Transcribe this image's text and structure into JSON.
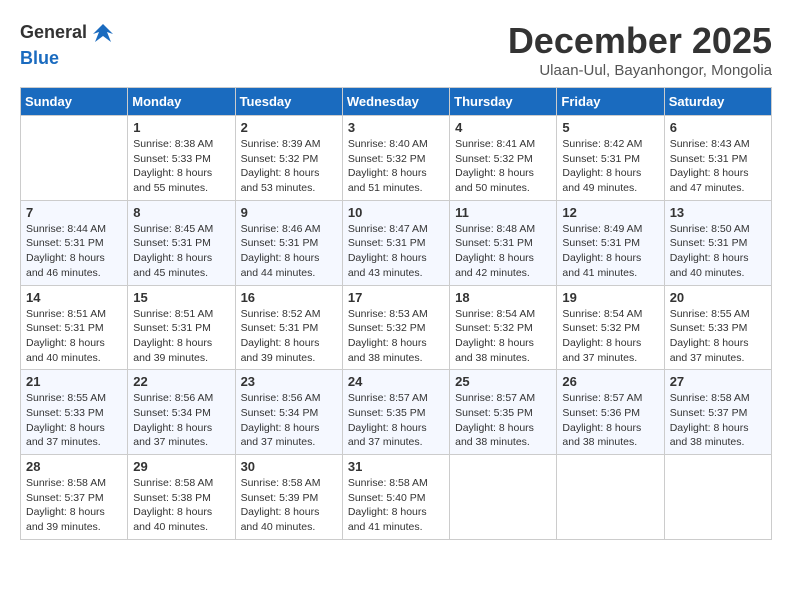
{
  "header": {
    "logo_general": "General",
    "logo_blue": "Blue",
    "month_title": "December 2025",
    "subtitle": "Ulaan-Uul, Bayanhongor, Mongolia"
  },
  "days_of_week": [
    "Sunday",
    "Monday",
    "Tuesday",
    "Wednesday",
    "Thursday",
    "Friday",
    "Saturday"
  ],
  "weeks": [
    [
      {
        "day": "",
        "sunrise": "",
        "sunset": "",
        "daylight": ""
      },
      {
        "day": "1",
        "sunrise": "Sunrise: 8:38 AM",
        "sunset": "Sunset: 5:33 PM",
        "daylight": "Daylight: 8 hours and 55 minutes."
      },
      {
        "day": "2",
        "sunrise": "Sunrise: 8:39 AM",
        "sunset": "Sunset: 5:32 PM",
        "daylight": "Daylight: 8 hours and 53 minutes."
      },
      {
        "day": "3",
        "sunrise": "Sunrise: 8:40 AM",
        "sunset": "Sunset: 5:32 PM",
        "daylight": "Daylight: 8 hours and 51 minutes."
      },
      {
        "day": "4",
        "sunrise": "Sunrise: 8:41 AM",
        "sunset": "Sunset: 5:32 PM",
        "daylight": "Daylight: 8 hours and 50 minutes."
      },
      {
        "day": "5",
        "sunrise": "Sunrise: 8:42 AM",
        "sunset": "Sunset: 5:31 PM",
        "daylight": "Daylight: 8 hours and 49 minutes."
      },
      {
        "day": "6",
        "sunrise": "Sunrise: 8:43 AM",
        "sunset": "Sunset: 5:31 PM",
        "daylight": "Daylight: 8 hours and 47 minutes."
      }
    ],
    [
      {
        "day": "7",
        "sunrise": "Sunrise: 8:44 AM",
        "sunset": "Sunset: 5:31 PM",
        "daylight": "Daylight: 8 hours and 46 minutes."
      },
      {
        "day": "8",
        "sunrise": "Sunrise: 8:45 AM",
        "sunset": "Sunset: 5:31 PM",
        "daylight": "Daylight: 8 hours and 45 minutes."
      },
      {
        "day": "9",
        "sunrise": "Sunrise: 8:46 AM",
        "sunset": "Sunset: 5:31 PM",
        "daylight": "Daylight: 8 hours and 44 minutes."
      },
      {
        "day": "10",
        "sunrise": "Sunrise: 8:47 AM",
        "sunset": "Sunset: 5:31 PM",
        "daylight": "Daylight: 8 hours and 43 minutes."
      },
      {
        "day": "11",
        "sunrise": "Sunrise: 8:48 AM",
        "sunset": "Sunset: 5:31 PM",
        "daylight": "Daylight: 8 hours and 42 minutes."
      },
      {
        "day": "12",
        "sunrise": "Sunrise: 8:49 AM",
        "sunset": "Sunset: 5:31 PM",
        "daylight": "Daylight: 8 hours and 41 minutes."
      },
      {
        "day": "13",
        "sunrise": "Sunrise: 8:50 AM",
        "sunset": "Sunset: 5:31 PM",
        "daylight": "Daylight: 8 hours and 40 minutes."
      }
    ],
    [
      {
        "day": "14",
        "sunrise": "Sunrise: 8:51 AM",
        "sunset": "Sunset: 5:31 PM",
        "daylight": "Daylight: 8 hours and 40 minutes."
      },
      {
        "day": "15",
        "sunrise": "Sunrise: 8:51 AM",
        "sunset": "Sunset: 5:31 PM",
        "daylight": "Daylight: 8 hours and 39 minutes."
      },
      {
        "day": "16",
        "sunrise": "Sunrise: 8:52 AM",
        "sunset": "Sunset: 5:31 PM",
        "daylight": "Daylight: 8 hours and 39 minutes."
      },
      {
        "day": "17",
        "sunrise": "Sunrise: 8:53 AM",
        "sunset": "Sunset: 5:32 PM",
        "daylight": "Daylight: 8 hours and 38 minutes."
      },
      {
        "day": "18",
        "sunrise": "Sunrise: 8:54 AM",
        "sunset": "Sunset: 5:32 PM",
        "daylight": "Daylight: 8 hours and 38 minutes."
      },
      {
        "day": "19",
        "sunrise": "Sunrise: 8:54 AM",
        "sunset": "Sunset: 5:32 PM",
        "daylight": "Daylight: 8 hours and 37 minutes."
      },
      {
        "day": "20",
        "sunrise": "Sunrise: 8:55 AM",
        "sunset": "Sunset: 5:33 PM",
        "daylight": "Daylight: 8 hours and 37 minutes."
      }
    ],
    [
      {
        "day": "21",
        "sunrise": "Sunrise: 8:55 AM",
        "sunset": "Sunset: 5:33 PM",
        "daylight": "Daylight: 8 hours and 37 minutes."
      },
      {
        "day": "22",
        "sunrise": "Sunrise: 8:56 AM",
        "sunset": "Sunset: 5:34 PM",
        "daylight": "Daylight: 8 hours and 37 minutes."
      },
      {
        "day": "23",
        "sunrise": "Sunrise: 8:56 AM",
        "sunset": "Sunset: 5:34 PM",
        "daylight": "Daylight: 8 hours and 37 minutes."
      },
      {
        "day": "24",
        "sunrise": "Sunrise: 8:57 AM",
        "sunset": "Sunset: 5:35 PM",
        "daylight": "Daylight: 8 hours and 37 minutes."
      },
      {
        "day": "25",
        "sunrise": "Sunrise: 8:57 AM",
        "sunset": "Sunset: 5:35 PM",
        "daylight": "Daylight: 8 hours and 38 minutes."
      },
      {
        "day": "26",
        "sunrise": "Sunrise: 8:57 AM",
        "sunset": "Sunset: 5:36 PM",
        "daylight": "Daylight: 8 hours and 38 minutes."
      },
      {
        "day": "27",
        "sunrise": "Sunrise: 8:58 AM",
        "sunset": "Sunset: 5:37 PM",
        "daylight": "Daylight: 8 hours and 38 minutes."
      }
    ],
    [
      {
        "day": "28",
        "sunrise": "Sunrise: 8:58 AM",
        "sunset": "Sunset: 5:37 PM",
        "daylight": "Daylight: 8 hours and 39 minutes."
      },
      {
        "day": "29",
        "sunrise": "Sunrise: 8:58 AM",
        "sunset": "Sunset: 5:38 PM",
        "daylight": "Daylight: 8 hours and 40 minutes."
      },
      {
        "day": "30",
        "sunrise": "Sunrise: 8:58 AM",
        "sunset": "Sunset: 5:39 PM",
        "daylight": "Daylight: 8 hours and 40 minutes."
      },
      {
        "day": "31",
        "sunrise": "Sunrise: 8:58 AM",
        "sunset": "Sunset: 5:40 PM",
        "daylight": "Daylight: 8 hours and 41 minutes."
      },
      {
        "day": "",
        "sunrise": "",
        "sunset": "",
        "daylight": ""
      },
      {
        "day": "",
        "sunrise": "",
        "sunset": "",
        "daylight": ""
      },
      {
        "day": "",
        "sunrise": "",
        "sunset": "",
        "daylight": ""
      }
    ]
  ]
}
